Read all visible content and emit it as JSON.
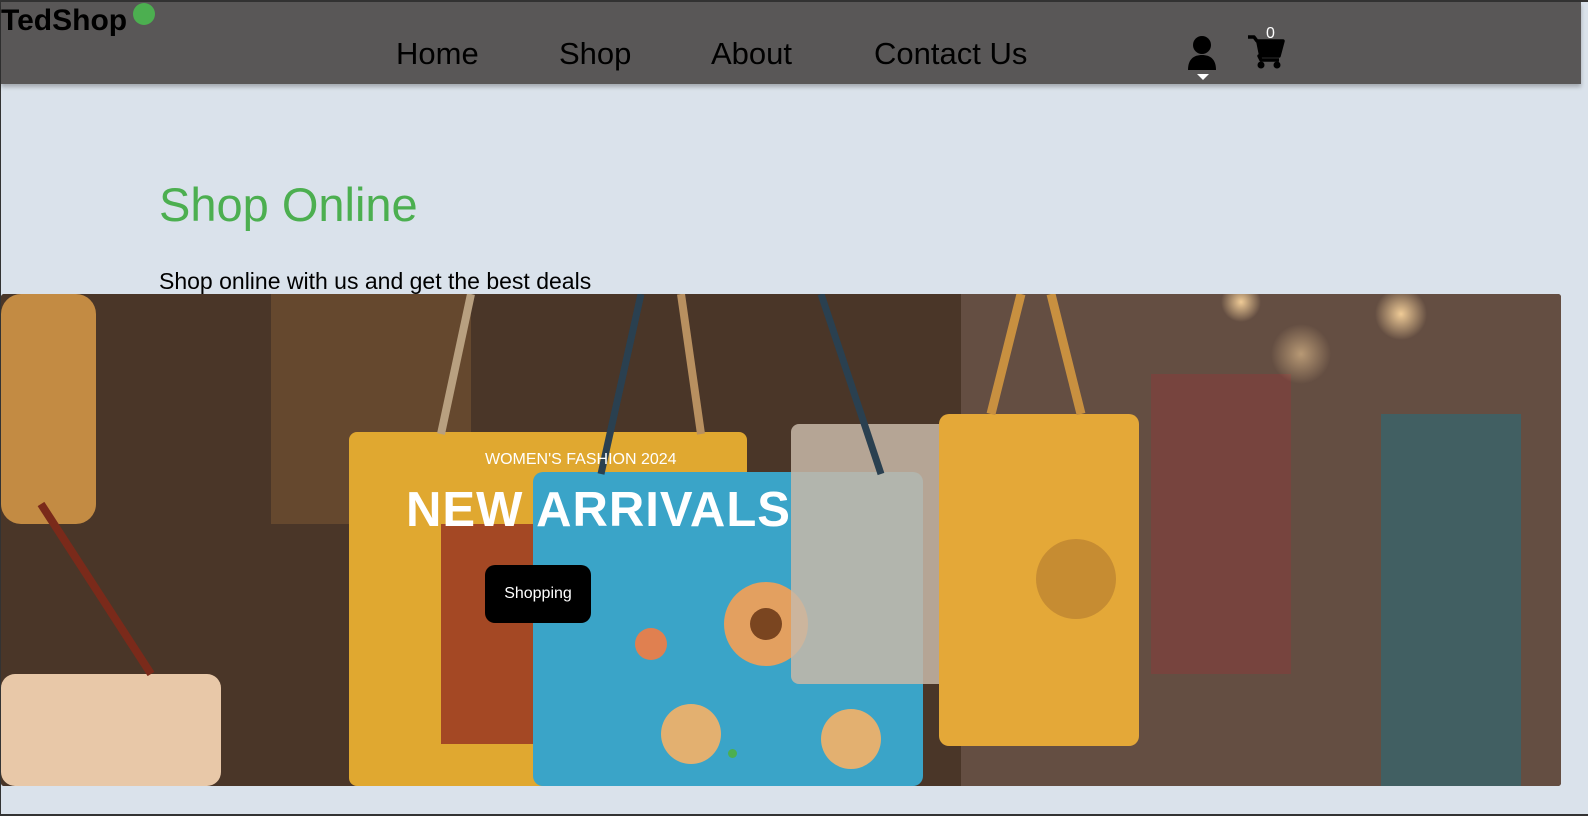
{
  "brand": {
    "name": "TedShop",
    "accent_color": "#4caf50",
    "nav_bg": "#595757"
  },
  "nav": {
    "items": [
      {
        "label": "Home"
      },
      {
        "label": "Shop"
      },
      {
        "label": "About"
      },
      {
        "label": "Contact Us"
      }
    ],
    "user_icon": "user-icon",
    "cart_icon": "shopping-cart-icon",
    "cart_count": "0"
  },
  "hero": {
    "title": "Shop Online",
    "subtitle": "Shop online with us and get the best deals"
  },
  "banner": {
    "kicker": "WOMEN'S FASHION 2024",
    "heading": "NEW ARRIVALS",
    "button_label": "Shopping",
    "image_subject": "colorful embroidered handbags hanging in a market"
  }
}
